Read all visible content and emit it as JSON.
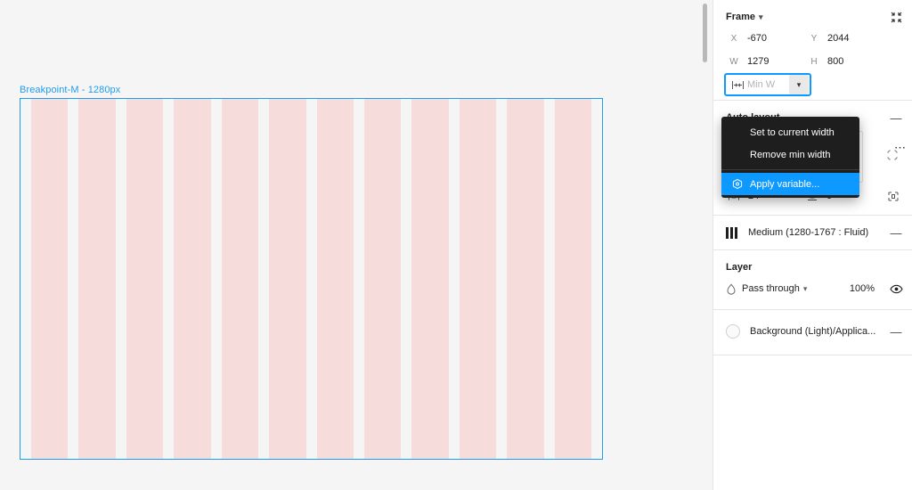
{
  "canvas": {
    "frame_label": "Breakpoint-M - 1280px",
    "grid_columns": 12,
    "frame_border_color": "#1f9cf0",
    "column_color": "#f7dcdc",
    "background_color": "#f5f5f5"
  },
  "panel": {
    "frame_section": {
      "title": "Frame",
      "chevron": "chevron-down-icon",
      "collapse_icon": "collapse-arrows-icon",
      "fields": [
        {
          "label": "X",
          "value": "-670"
        },
        {
          "label": "Y",
          "value": "2044"
        },
        {
          "label": "W",
          "value": "1279"
        },
        {
          "label": "H",
          "value": "800"
        }
      ],
      "min_width": {
        "icon": "min-width-icon",
        "icon_glyph": "→|←",
        "placeholder": "Min W",
        "value": "",
        "chevron": "chevron-down-icon"
      },
      "constraints_icon": "hug-contents-icon"
    },
    "context_menu": {
      "items": [
        {
          "label": "Set to current width",
          "selected": false,
          "icon": null
        },
        {
          "label": "Remove min width",
          "selected": false,
          "icon": null
        },
        {
          "label": "Apply variable...",
          "selected": true,
          "icon": "variable-icon"
        }
      ],
      "highlight_color": "#0d99ff",
      "background_color": "#1e1e1e"
    },
    "auto_layout": {
      "title": "Auto layout",
      "collapse_label": "—",
      "direction_buttons": [
        {
          "name": "vertical",
          "glyph": "↓",
          "active": true
        },
        {
          "name": "horizontal",
          "glyph": "→",
          "active": false
        },
        {
          "name": "wrap",
          "glyph": "↩",
          "active": false
        }
      ],
      "gap": {
        "icon": "gap-spacing-icon",
        "value": "0"
      },
      "horizontal_padding": {
        "icon": "horizontal-padding-icon",
        "value": "24"
      },
      "vertical_padding": {
        "icon": "vertical-padding-icon",
        "value": "0"
      },
      "individual_padding_icon": "individual-padding-icon",
      "more_options_icon": "more-options-icon",
      "alignment": "top-left"
    },
    "breakpoint_section": {
      "icon": "layout-grid-icon",
      "label": "Medium (1280-1767 : Fluid)",
      "collapse_label": "—"
    },
    "layer_section": {
      "title": "Layer",
      "blend_icon": "blend-mode-icon",
      "blend_mode": "Pass through",
      "chevron": "chevron-down-icon",
      "opacity": "100%",
      "visibility_icon": "eye-icon"
    },
    "fill_section": {
      "swatch_name": "Background (Light)/Applica...",
      "swatch_color": "#fafafa",
      "remove_label": "—"
    }
  }
}
